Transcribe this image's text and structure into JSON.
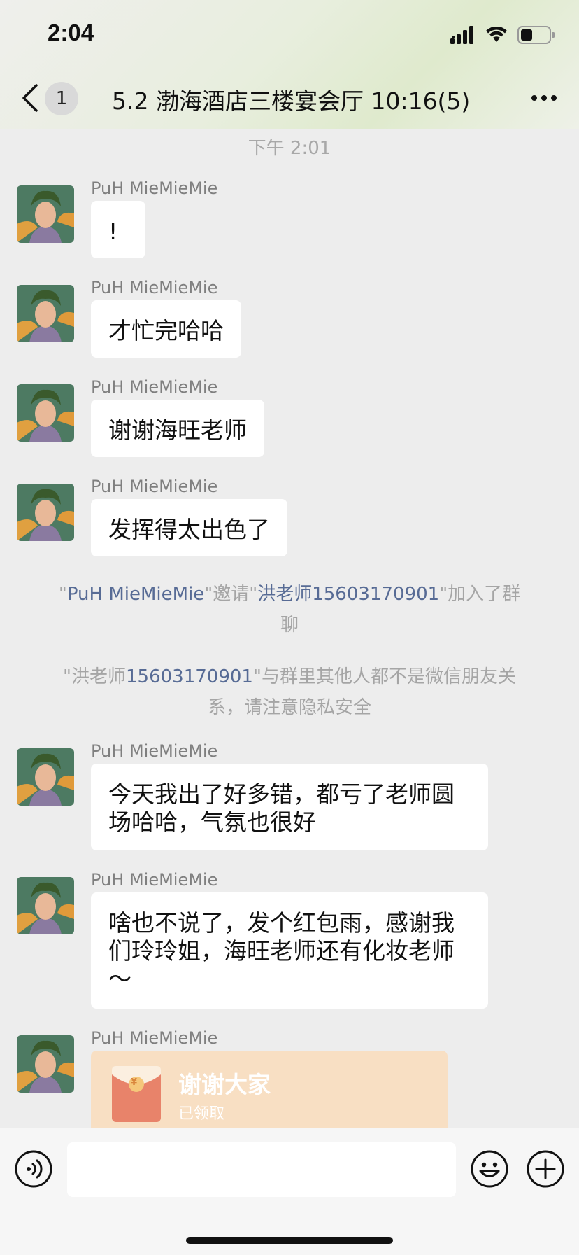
{
  "status_bar": {
    "time": "2:04"
  },
  "header": {
    "unread_count": "1",
    "title": "5.2 渤海酒店三楼宴会厅 10:16(5)"
  },
  "chat": {
    "time_divider": "下午 2:01",
    "messages": [
      {
        "sender": "PuH MieMieMie",
        "text": "!"
      },
      {
        "sender": "PuH MieMieMie",
        "text": "才忙完哈哈"
      },
      {
        "sender": "PuH MieMieMie",
        "text": "谢谢海旺老师"
      },
      {
        "sender": "PuH MieMieMie",
        "text": "发挥得太出色了"
      },
      {
        "sender": "PuH MieMieMie",
        "line1": "今天我出了好多错，都亏了老师圆",
        "line2": "场哈哈，气氛也很好"
      },
      {
        "sender": "PuH MieMieMie",
        "line1": "啥也不说了，发个红包雨，感谢我",
        "line2": "们玲玲姐，海旺老师还有化妆老师",
        "line3": "～"
      },
      {
        "sender": "PuH MieMieMie"
      }
    ],
    "system1": {
      "q1": "\"",
      "inviter": "PuH MieMieMie",
      "mid": "\"邀请\"",
      "invitee": "洪老师15603170901",
      "tail": "\"加入了群",
      "tail2": "聊"
    },
    "system2": {
      "q1": "\"洪老师",
      "number": "15603170901",
      "tail": "\"与群里其他人都不是微信朋友关",
      "tail2": "系，请注意隐私安全"
    },
    "red_packet": {
      "title": "谢谢大家",
      "status": "已领取",
      "symbol": "¥"
    }
  },
  "input": {
    "placeholder": ""
  }
}
